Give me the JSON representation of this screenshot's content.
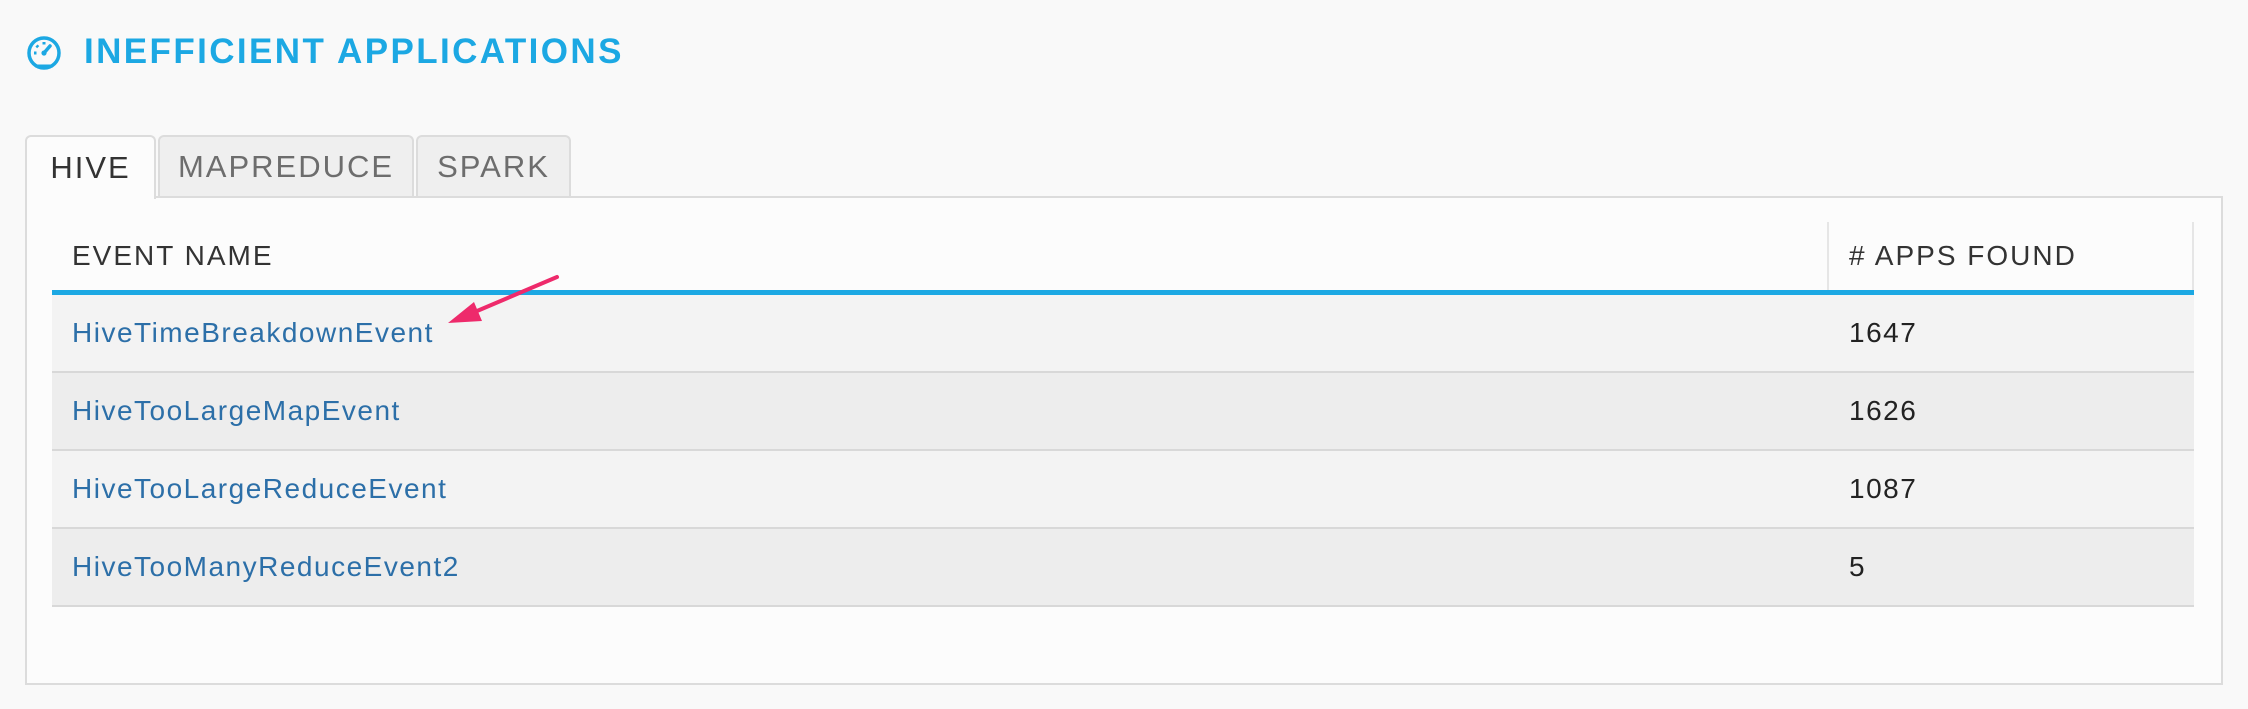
{
  "header": {
    "title": "INEFFICIENT APPLICATIONS",
    "icon": "speedometer-icon",
    "accent_color": "#1ca8e3"
  },
  "tabs": [
    {
      "label": "HIVE",
      "active": true
    },
    {
      "label": "MAPREDUCE",
      "active": false
    },
    {
      "label": "SPARK",
      "active": false
    }
  ],
  "table": {
    "columns": [
      "EVENT NAME",
      "# APPS FOUND"
    ],
    "rows": [
      {
        "event_name": "HiveTimeBreakdownEvent",
        "apps_found": "1647"
      },
      {
        "event_name": "HiveTooLargeMapEvent",
        "apps_found": "1626"
      },
      {
        "event_name": "HiveTooLargeReduceEvent",
        "apps_found": "1087"
      },
      {
        "event_name": "HiveTooManyReduceEvent2",
        "apps_found": "5"
      }
    ]
  },
  "annotation": {
    "icon": "pointer-arrow-icon",
    "color": "#ee2a6b"
  }
}
